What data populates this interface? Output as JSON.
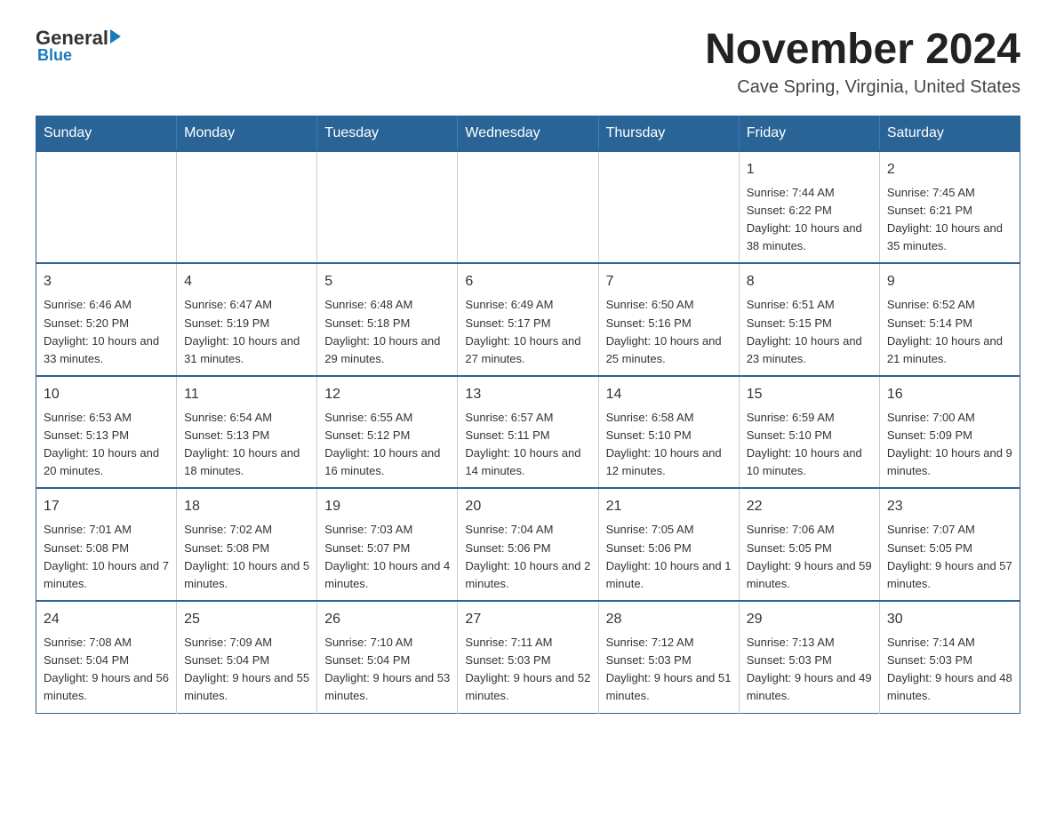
{
  "logo": {
    "general": "General",
    "blue": "Blue"
  },
  "header": {
    "month": "November 2024",
    "location": "Cave Spring, Virginia, United States"
  },
  "weekdays": [
    "Sunday",
    "Monday",
    "Tuesday",
    "Wednesday",
    "Thursday",
    "Friday",
    "Saturday"
  ],
  "weeks": [
    [
      {
        "day": "",
        "sunrise": "",
        "sunset": "",
        "daylight": ""
      },
      {
        "day": "",
        "sunrise": "",
        "sunset": "",
        "daylight": ""
      },
      {
        "day": "",
        "sunrise": "",
        "sunset": "",
        "daylight": ""
      },
      {
        "day": "",
        "sunrise": "",
        "sunset": "",
        "daylight": ""
      },
      {
        "day": "",
        "sunrise": "",
        "sunset": "",
        "daylight": ""
      },
      {
        "day": "1",
        "sunrise": "Sunrise: 7:44 AM",
        "sunset": "Sunset: 6:22 PM",
        "daylight": "Daylight: 10 hours and 38 minutes."
      },
      {
        "day": "2",
        "sunrise": "Sunrise: 7:45 AM",
        "sunset": "Sunset: 6:21 PM",
        "daylight": "Daylight: 10 hours and 35 minutes."
      }
    ],
    [
      {
        "day": "3",
        "sunrise": "Sunrise: 6:46 AM",
        "sunset": "Sunset: 5:20 PM",
        "daylight": "Daylight: 10 hours and 33 minutes."
      },
      {
        "day": "4",
        "sunrise": "Sunrise: 6:47 AM",
        "sunset": "Sunset: 5:19 PM",
        "daylight": "Daylight: 10 hours and 31 minutes."
      },
      {
        "day": "5",
        "sunrise": "Sunrise: 6:48 AM",
        "sunset": "Sunset: 5:18 PM",
        "daylight": "Daylight: 10 hours and 29 minutes."
      },
      {
        "day": "6",
        "sunrise": "Sunrise: 6:49 AM",
        "sunset": "Sunset: 5:17 PM",
        "daylight": "Daylight: 10 hours and 27 minutes."
      },
      {
        "day": "7",
        "sunrise": "Sunrise: 6:50 AM",
        "sunset": "Sunset: 5:16 PM",
        "daylight": "Daylight: 10 hours and 25 minutes."
      },
      {
        "day": "8",
        "sunrise": "Sunrise: 6:51 AM",
        "sunset": "Sunset: 5:15 PM",
        "daylight": "Daylight: 10 hours and 23 minutes."
      },
      {
        "day": "9",
        "sunrise": "Sunrise: 6:52 AM",
        "sunset": "Sunset: 5:14 PM",
        "daylight": "Daylight: 10 hours and 21 minutes."
      }
    ],
    [
      {
        "day": "10",
        "sunrise": "Sunrise: 6:53 AM",
        "sunset": "Sunset: 5:13 PM",
        "daylight": "Daylight: 10 hours and 20 minutes."
      },
      {
        "day": "11",
        "sunrise": "Sunrise: 6:54 AM",
        "sunset": "Sunset: 5:13 PM",
        "daylight": "Daylight: 10 hours and 18 minutes."
      },
      {
        "day": "12",
        "sunrise": "Sunrise: 6:55 AM",
        "sunset": "Sunset: 5:12 PM",
        "daylight": "Daylight: 10 hours and 16 minutes."
      },
      {
        "day": "13",
        "sunrise": "Sunrise: 6:57 AM",
        "sunset": "Sunset: 5:11 PM",
        "daylight": "Daylight: 10 hours and 14 minutes."
      },
      {
        "day": "14",
        "sunrise": "Sunrise: 6:58 AM",
        "sunset": "Sunset: 5:10 PM",
        "daylight": "Daylight: 10 hours and 12 minutes."
      },
      {
        "day": "15",
        "sunrise": "Sunrise: 6:59 AM",
        "sunset": "Sunset: 5:10 PM",
        "daylight": "Daylight: 10 hours and 10 minutes."
      },
      {
        "day": "16",
        "sunrise": "Sunrise: 7:00 AM",
        "sunset": "Sunset: 5:09 PM",
        "daylight": "Daylight: 10 hours and 9 minutes."
      }
    ],
    [
      {
        "day": "17",
        "sunrise": "Sunrise: 7:01 AM",
        "sunset": "Sunset: 5:08 PM",
        "daylight": "Daylight: 10 hours and 7 minutes."
      },
      {
        "day": "18",
        "sunrise": "Sunrise: 7:02 AM",
        "sunset": "Sunset: 5:08 PM",
        "daylight": "Daylight: 10 hours and 5 minutes."
      },
      {
        "day": "19",
        "sunrise": "Sunrise: 7:03 AM",
        "sunset": "Sunset: 5:07 PM",
        "daylight": "Daylight: 10 hours and 4 minutes."
      },
      {
        "day": "20",
        "sunrise": "Sunrise: 7:04 AM",
        "sunset": "Sunset: 5:06 PM",
        "daylight": "Daylight: 10 hours and 2 minutes."
      },
      {
        "day": "21",
        "sunrise": "Sunrise: 7:05 AM",
        "sunset": "Sunset: 5:06 PM",
        "daylight": "Daylight: 10 hours and 1 minute."
      },
      {
        "day": "22",
        "sunrise": "Sunrise: 7:06 AM",
        "sunset": "Sunset: 5:05 PM",
        "daylight": "Daylight: 9 hours and 59 minutes."
      },
      {
        "day": "23",
        "sunrise": "Sunrise: 7:07 AM",
        "sunset": "Sunset: 5:05 PM",
        "daylight": "Daylight: 9 hours and 57 minutes."
      }
    ],
    [
      {
        "day": "24",
        "sunrise": "Sunrise: 7:08 AM",
        "sunset": "Sunset: 5:04 PM",
        "daylight": "Daylight: 9 hours and 56 minutes."
      },
      {
        "day": "25",
        "sunrise": "Sunrise: 7:09 AM",
        "sunset": "Sunset: 5:04 PM",
        "daylight": "Daylight: 9 hours and 55 minutes."
      },
      {
        "day": "26",
        "sunrise": "Sunrise: 7:10 AM",
        "sunset": "Sunset: 5:04 PM",
        "daylight": "Daylight: 9 hours and 53 minutes."
      },
      {
        "day": "27",
        "sunrise": "Sunrise: 7:11 AM",
        "sunset": "Sunset: 5:03 PM",
        "daylight": "Daylight: 9 hours and 52 minutes."
      },
      {
        "day": "28",
        "sunrise": "Sunrise: 7:12 AM",
        "sunset": "Sunset: 5:03 PM",
        "daylight": "Daylight: 9 hours and 51 minutes."
      },
      {
        "day": "29",
        "sunrise": "Sunrise: 7:13 AM",
        "sunset": "Sunset: 5:03 PM",
        "daylight": "Daylight: 9 hours and 49 minutes."
      },
      {
        "day": "30",
        "sunrise": "Sunrise: 7:14 AM",
        "sunset": "Sunset: 5:03 PM",
        "daylight": "Daylight: 9 hours and 48 minutes."
      }
    ]
  ]
}
